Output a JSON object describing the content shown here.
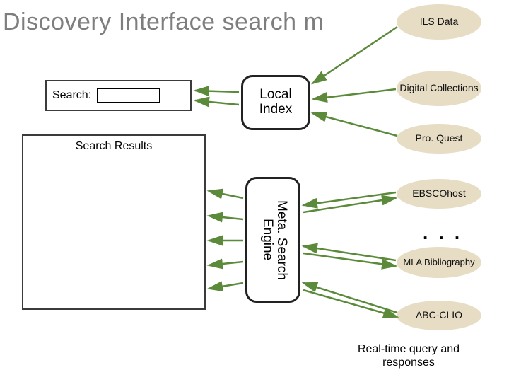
{
  "title": "Discovery Interface search m",
  "search": {
    "label": "Search:",
    "value": ""
  },
  "results": {
    "heading": "Search Results"
  },
  "nodes": {
    "local_index": "Local Index",
    "meta_engine": "Meta. Search Engine"
  },
  "sources": {
    "ils": "ILS Data",
    "digital": "Digital Collections",
    "proquest": "Pro. Quest",
    "ebsco": "EBSCOhost",
    "mla": "MLA Bibliography",
    "abc": "ABC-CLIO"
  },
  "ellipsis": ". . .",
  "footer": "Real-time query and responses"
}
